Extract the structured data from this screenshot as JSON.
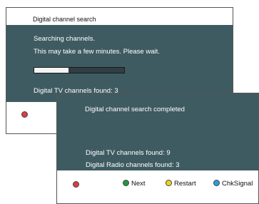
{
  "search_screen": {
    "title": "Digital channel search",
    "line1": "Searching channels.",
    "line2": "This may take a few minutes.  Please wait.",
    "progress": 0.38,
    "found_label": "Digital TV channels found:  3"
  },
  "complete_dialog": {
    "title": "Digital channel search completed",
    "tv_found": "Digital  TV channels found:  9",
    "radio_found": "Digital  Radio channels found:  3"
  },
  "buttons": {
    "next": "Next",
    "restart": "Restart",
    "chksignal": "ChkSignal"
  },
  "colors": {
    "panel_bg": "#3f5b62",
    "red": "#e03a48",
    "green": "#1f9a3e",
    "yellow": "#f2d21a",
    "blue": "#2a9ed8"
  }
}
